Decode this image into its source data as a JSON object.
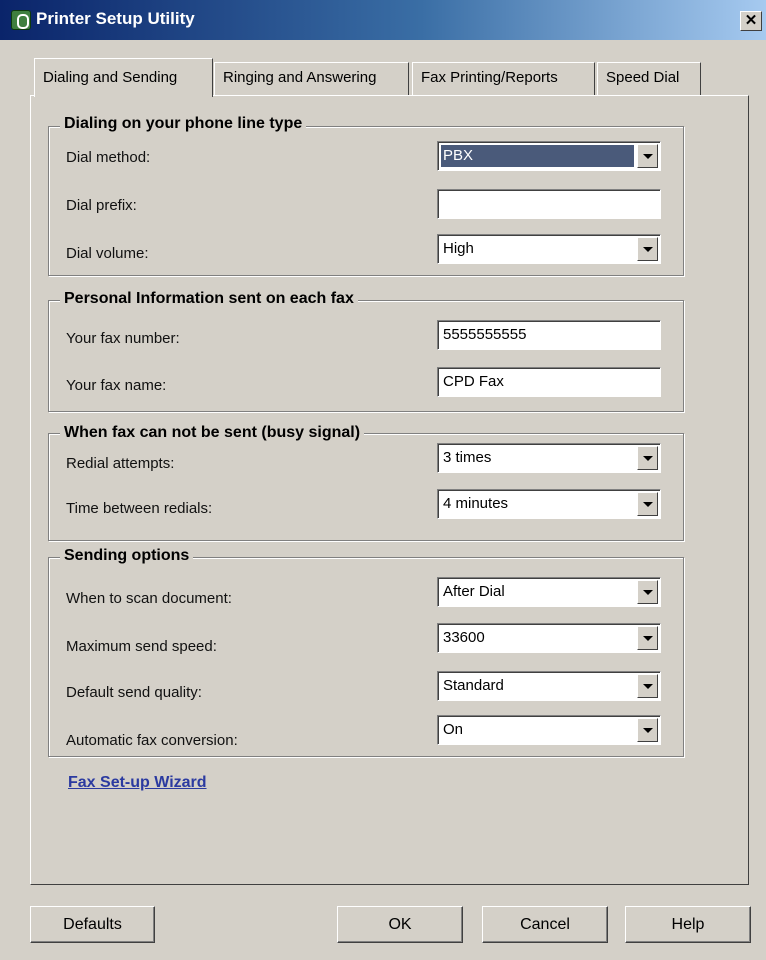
{
  "window": {
    "title": "Printer Setup Utility",
    "close_glyph": "✕"
  },
  "tabs": [
    {
      "label": "Dialing and Sending",
      "active": true
    },
    {
      "label": "Ringing and Answering",
      "active": false
    },
    {
      "label": "Fax Printing/Reports",
      "active": false
    },
    {
      "label": "Speed Dial",
      "active": false
    }
  ],
  "groups": {
    "dialing": {
      "title": "Dialing on your phone line type",
      "dial_method": {
        "label": "Dial method:",
        "value": "PBX"
      },
      "dial_prefix": {
        "label": "Dial prefix:",
        "value": ""
      },
      "dial_volume": {
        "label": "Dial volume:",
        "value": "High"
      }
    },
    "personal": {
      "title": "Personal Information sent on each fax",
      "fax_number": {
        "label": "Your fax number:",
        "value": "5555555555"
      },
      "fax_name": {
        "label": "Your fax name:",
        "value": "CPD Fax"
      }
    },
    "busy": {
      "title": "When fax can not be sent (busy signal)",
      "redial_attempts": {
        "label": "Redial attempts:",
        "value": "3 times"
      },
      "time_between": {
        "label": "Time between redials:",
        "value": "4 minutes"
      }
    },
    "sending": {
      "title": "Sending options",
      "scan_document": {
        "label": "When to scan document:",
        "value": "After Dial"
      },
      "max_speed": {
        "label": "Maximum send speed:",
        "value": "33600"
      },
      "send_quality": {
        "label": "Default send quality:",
        "value": "Standard"
      },
      "auto_conversion": {
        "label": "Automatic fax conversion:",
        "value": "On"
      }
    }
  },
  "wizard_link": "Fax Set-up Wizard",
  "buttons": {
    "defaults": "Defaults",
    "ok": "OK",
    "cancel": "Cancel",
    "help": "Help"
  },
  "icons": [
    "printer-utility-icon",
    "close-icon",
    "chevron-down-icon"
  ],
  "colors": {
    "titlebar_start": "#0a246a",
    "titlebar_end": "#a6caf0",
    "window_face": "#d4d0c8",
    "link": "#2b3aa0",
    "selection": "#4a5a7a"
  }
}
